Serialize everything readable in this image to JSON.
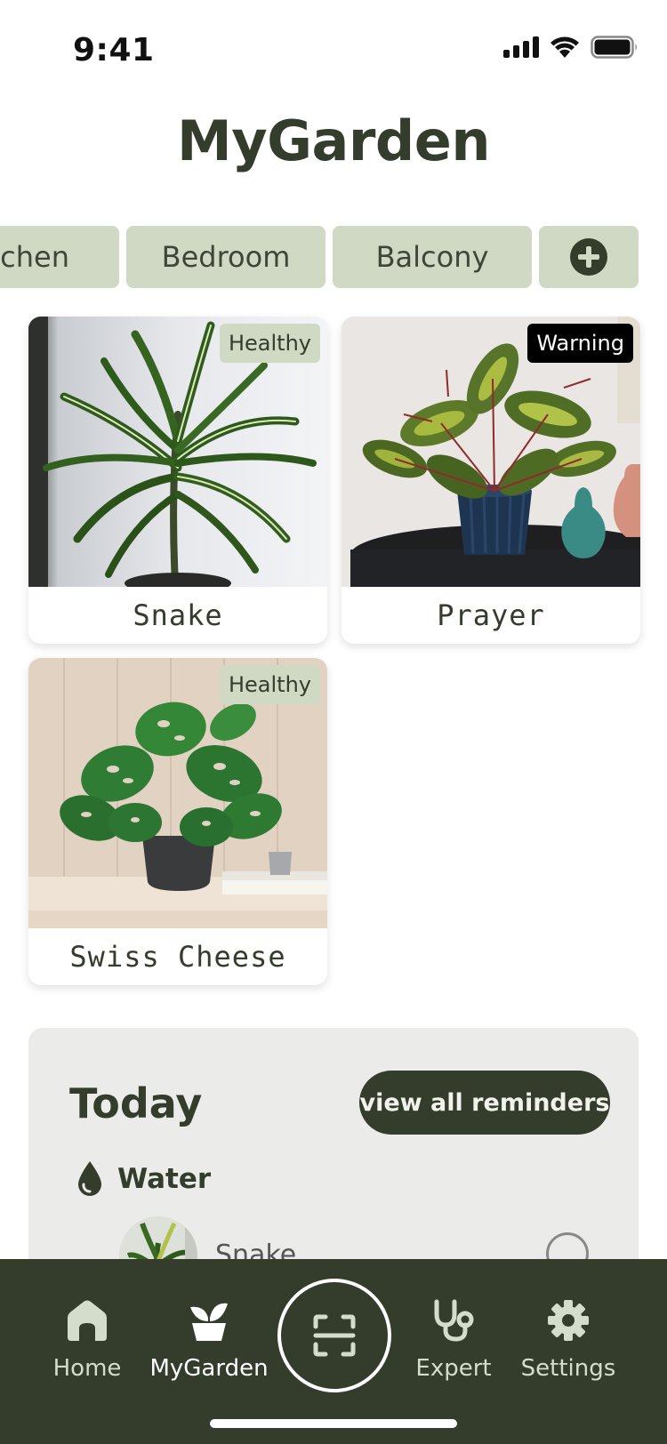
{
  "status_bar": {
    "time": "9:41"
  },
  "header": {
    "title": "MyGarden"
  },
  "rooms": [
    {
      "label": "Kitchen"
    },
    {
      "label": "Bedroom"
    },
    {
      "label": "Balcony"
    }
  ],
  "plants": [
    {
      "name": "Snake",
      "status": "Healthy"
    },
    {
      "name": "Prayer",
      "status": "Warning"
    },
    {
      "name": "Swiss Cheese",
      "status": "Healthy"
    }
  ],
  "today": {
    "title": "Today",
    "view_all_label": "view all reminders",
    "task": {
      "label": "Water",
      "icon": "water-drop-icon"
    },
    "reminders": [
      {
        "plant": "Snake"
      }
    ]
  },
  "nav": {
    "items": [
      {
        "label": "Home",
        "icon": "home-icon"
      },
      {
        "label": "MyGarden",
        "icon": "plant-pot-icon"
      },
      {
        "label": "Expert",
        "icon": "stethoscope-icon"
      },
      {
        "label": "Settings",
        "icon": "gear-icon"
      }
    ],
    "scan_icon": "scan-icon"
  },
  "colors": {
    "primary": "#343c2c",
    "chip_bg": "#cfd9c4",
    "panel_bg": "#ebecea",
    "warning": "#000000"
  }
}
